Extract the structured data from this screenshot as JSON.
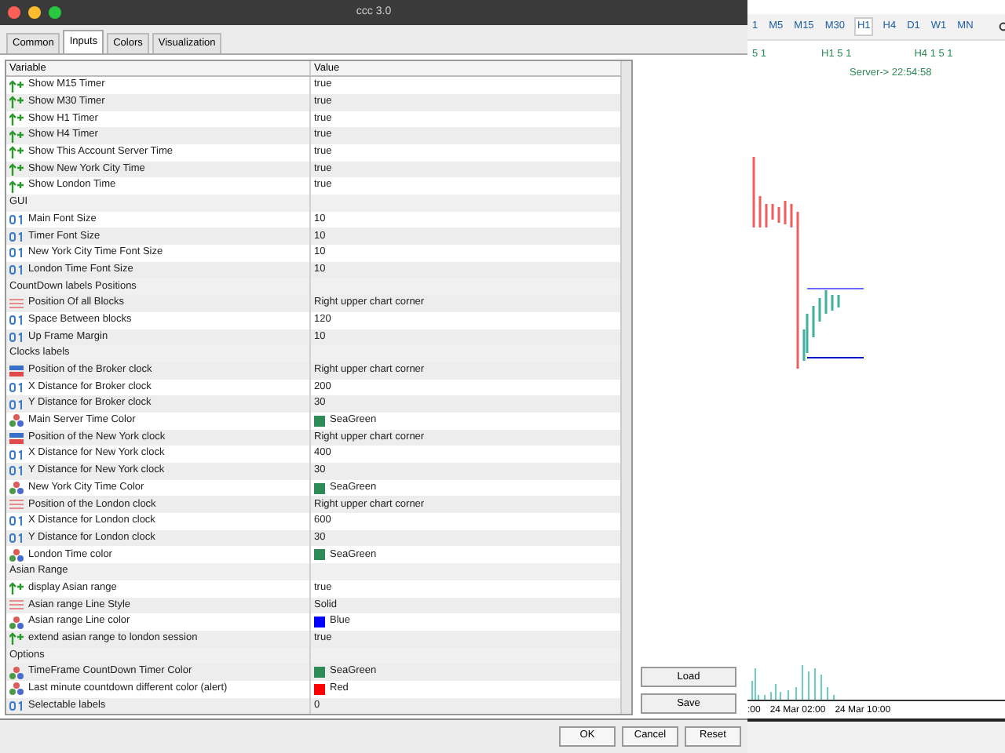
{
  "window": {
    "title": "ccc 3.0"
  },
  "tabs": [
    {
      "label": "Common",
      "selected": false
    },
    {
      "label": "Inputs",
      "selected": true
    },
    {
      "label": "Colors",
      "selected": false
    },
    {
      "label": "Visualization",
      "selected": false
    }
  ],
  "table": {
    "columns": [
      "Variable",
      "Value"
    ],
    "rows": [
      {
        "kind": "bool",
        "variable": "Show M15 Timer",
        "value": "true"
      },
      {
        "kind": "bool",
        "variable": "Show M30 Timer",
        "value": "true"
      },
      {
        "kind": "bool",
        "variable": "Show H1 Timer",
        "value": "true"
      },
      {
        "kind": "bool",
        "variable": "Show H4 Timer",
        "value": "true"
      },
      {
        "kind": "bool",
        "variable": "Show This Account Server Time",
        "value": "true"
      },
      {
        "kind": "bool",
        "variable": "Show New York City Time",
        "value": "true"
      },
      {
        "kind": "bool",
        "variable": "Show London Time",
        "value": "true"
      },
      {
        "kind": "heading",
        "variable": "GUI"
      },
      {
        "kind": "int",
        "variable": "Main Font Size",
        "value": "10"
      },
      {
        "kind": "int",
        "variable": "Timer Font Size",
        "value": "10"
      },
      {
        "kind": "int",
        "variable": "New York City Time Font Size",
        "value": "10"
      },
      {
        "kind": "int",
        "variable": "London Time Font Size",
        "value": "10"
      },
      {
        "kind": "heading",
        "variable": "CountDown labels Positions"
      },
      {
        "kind": "enum",
        "variable": "Position Of all Blocks",
        "value": "Right upper chart corner"
      },
      {
        "kind": "int",
        "variable": "Space Between blocks",
        "value": "120"
      },
      {
        "kind": "int",
        "variable": "Up Frame Margin",
        "value": "10"
      },
      {
        "kind": "heading",
        "variable": "Clocks labels"
      },
      {
        "kind": "corner",
        "variable": "Position of the Broker clock",
        "value": "Right upper chart corner"
      },
      {
        "kind": "int",
        "variable": "X Distance for Broker clock",
        "value": "200"
      },
      {
        "kind": "int",
        "variable": "Y Distance for Broker clock",
        "value": "30"
      },
      {
        "kind": "color",
        "variable": "Main Server Time Color",
        "value": "SeaGreen",
        "color": "#2e8b57"
      },
      {
        "kind": "corner",
        "variable": "Position of the New York clock",
        "value": "Right upper chart corner"
      },
      {
        "kind": "int",
        "variable": "X Distance for New York clock",
        "value": "400"
      },
      {
        "kind": "int",
        "variable": "Y Distance for New York clock",
        "value": "30"
      },
      {
        "kind": "color",
        "variable": "New York City Time Color",
        "value": "SeaGreen",
        "color": "#2e8b57"
      },
      {
        "kind": "enum",
        "variable": "Position of the London clock",
        "value": "Right upper chart corner"
      },
      {
        "kind": "int",
        "variable": "X Distance for London clock",
        "value": "600"
      },
      {
        "kind": "int",
        "variable": "Y Distance for London clock",
        "value": "30"
      },
      {
        "kind": "color",
        "variable": "London Time color",
        "value": "SeaGreen",
        "color": "#2e8b57"
      },
      {
        "kind": "heading",
        "variable": "Asian Range"
      },
      {
        "kind": "bool",
        "variable": "display Asian range",
        "value": "true"
      },
      {
        "kind": "enum",
        "variable": "Asian range Line Style",
        "value": "Solid"
      },
      {
        "kind": "color",
        "variable": "Asian range Line color",
        "value": "Blue",
        "color": "#0000ff"
      },
      {
        "kind": "bool",
        "variable": "extend asian range to london session",
        "value": "true"
      },
      {
        "kind": "heading",
        "variable": "Options"
      },
      {
        "kind": "color",
        "variable": "TimeFrame CountDown Timer Color",
        "value": "SeaGreen",
        "color": "#2e8b57"
      },
      {
        "kind": "color",
        "variable": "Last minute countdown different color (alert)",
        "value": "Red",
        "color": "#ff0000"
      },
      {
        "kind": "int",
        "variable": "Selectable labels",
        "value": "0"
      }
    ]
  },
  "side_buttons": [
    "Load",
    "Save"
  ],
  "buttons": [
    "OK",
    "Cancel",
    "Reset"
  ],
  "chart": {
    "timeframes": [
      {
        "label": "1",
        "selected": false
      },
      {
        "label": "M5",
        "selected": false
      },
      {
        "label": "M15",
        "selected": false
      },
      {
        "label": "M30",
        "selected": false
      },
      {
        "label": "H1",
        "selected": true
      },
      {
        "label": "H4",
        "selected": false
      },
      {
        "label": "D1",
        "selected": false
      },
      {
        "label": "W1",
        "selected": false
      },
      {
        "label": "MN",
        "selected": false
      }
    ],
    "labels": [
      "5 1",
      "H1 5 1",
      "H4 1 5 1"
    ],
    "server_time": "Server-> 22:54:58",
    "time_axis": [
      ":00",
      "24 Mar 02:00",
      "24 Mar 10:00"
    ]
  }
}
